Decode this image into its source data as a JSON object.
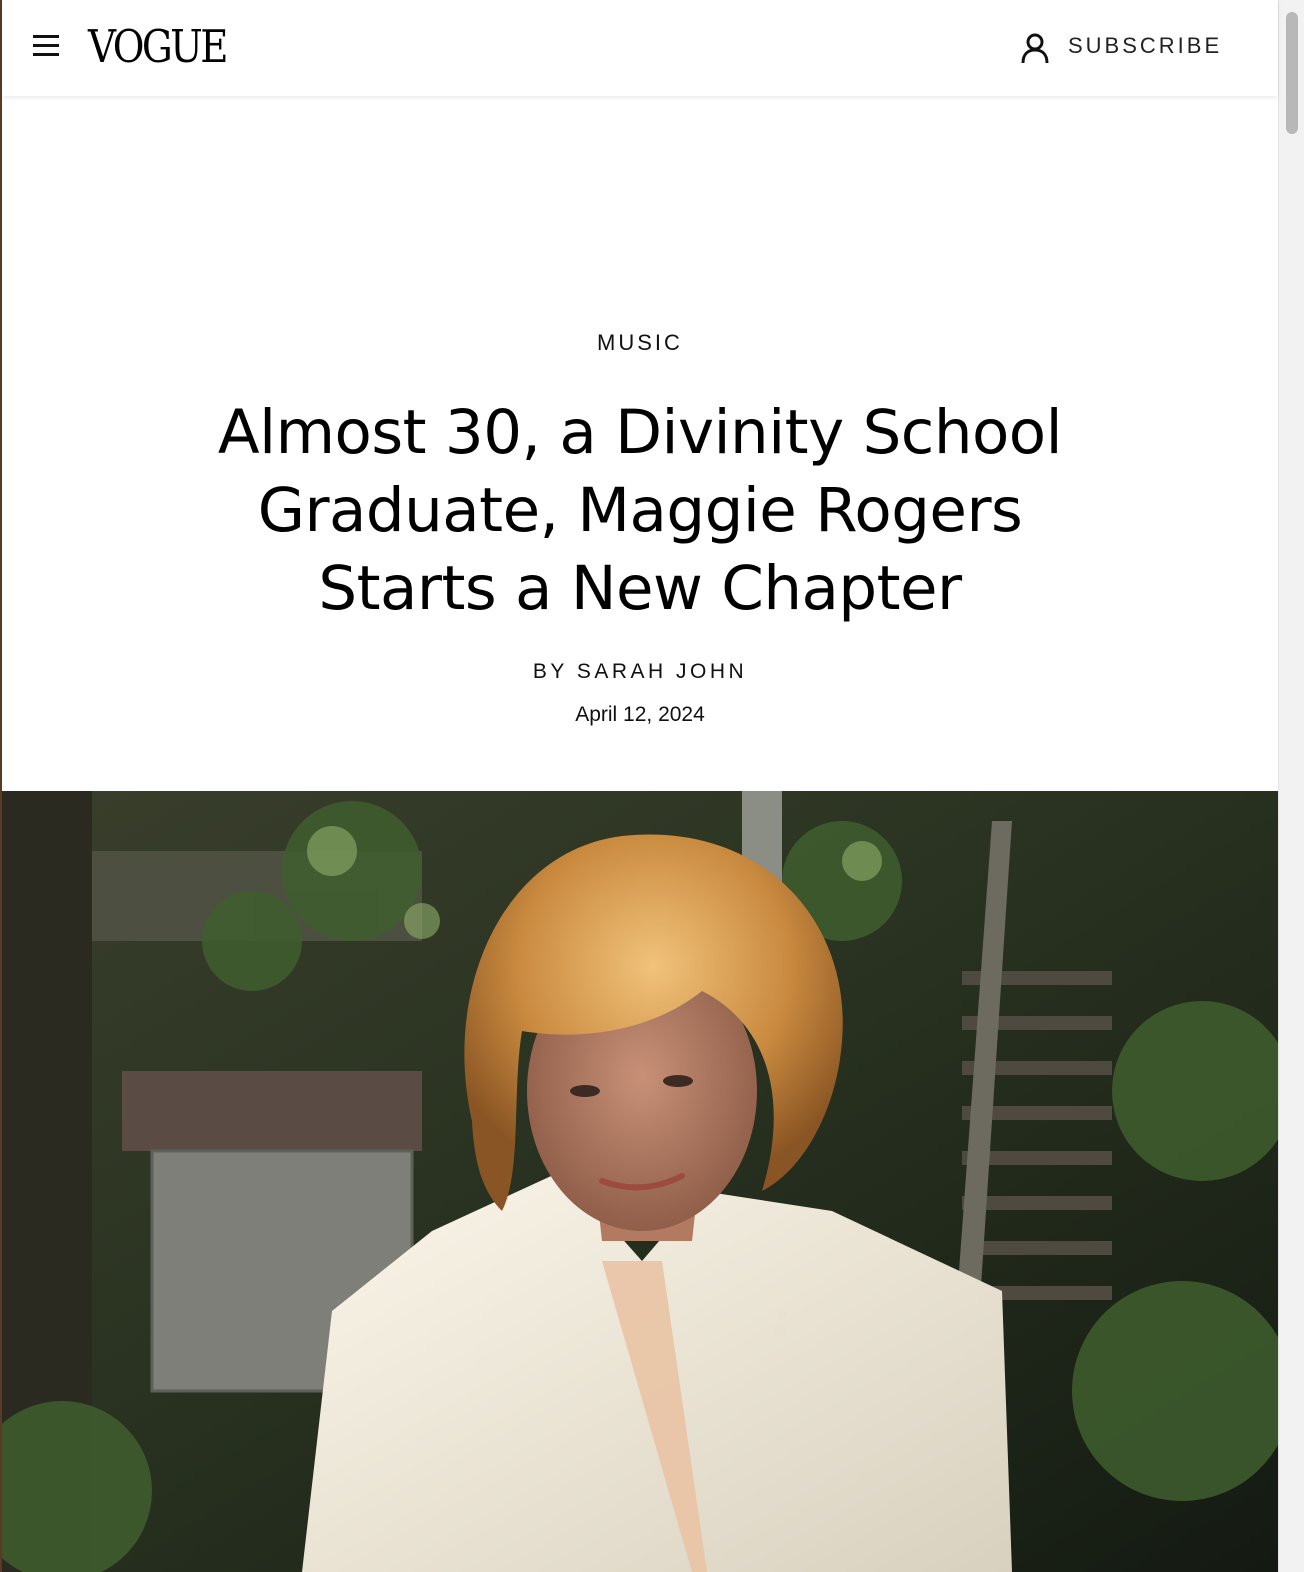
{
  "header": {
    "menu_icon": "hamburger-menu-icon",
    "logo_text": "VOGUE",
    "account_icon": "user-icon",
    "subscribe_label": "SUBSCRIBE"
  },
  "article": {
    "rubric": "MUSIC",
    "headline": "Almost 30, a Divinity School Graduate, Maggie Rogers Starts a New Chapter",
    "byline_prefix": "BY",
    "author": "SARAH JOHN",
    "date": "April 12, 2024"
  },
  "hero_image": {
    "description_icon": "photo"
  }
}
